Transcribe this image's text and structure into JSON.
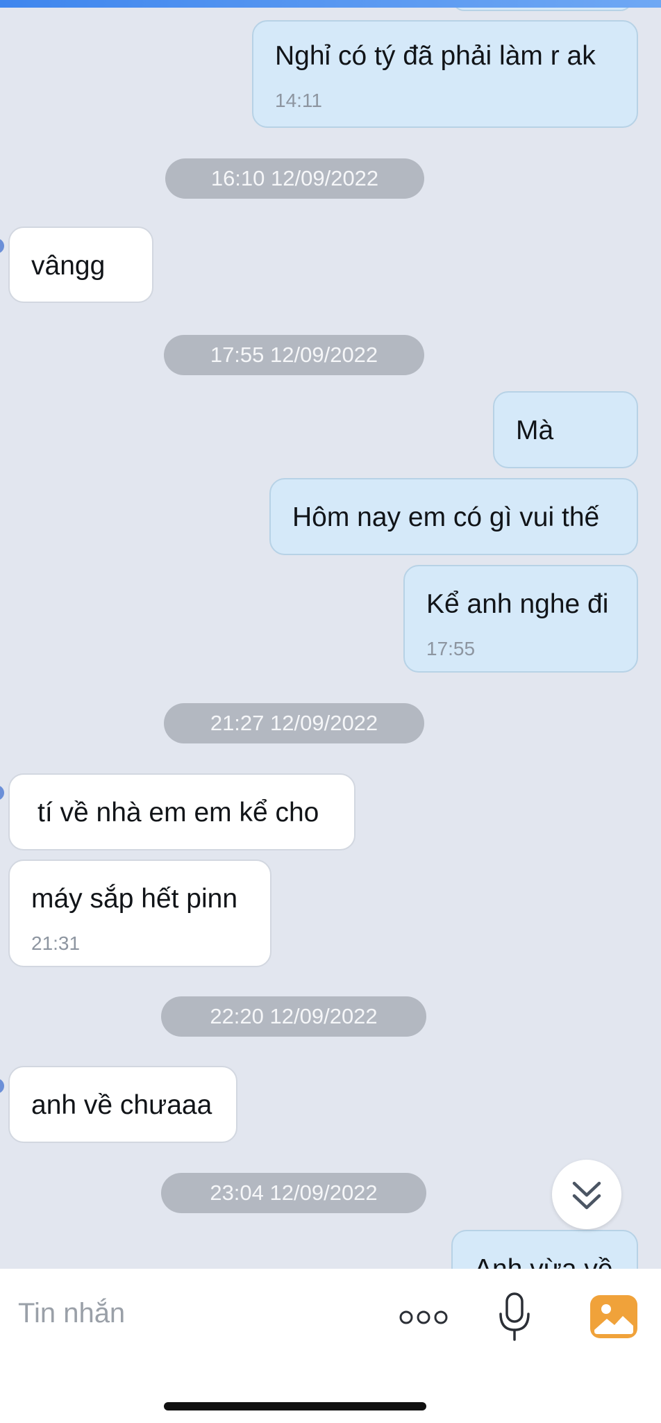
{
  "messages": [
    {
      "dir": "out",
      "text": "Nghỉ có tý đã phải làm r ak",
      "time": "14:11"
    },
    {
      "date": "16:10 12/09/2022"
    },
    {
      "dir": "in",
      "text": "vângg"
    },
    {
      "date": "17:55 12/09/2022"
    },
    {
      "dir": "out",
      "text": "Mà"
    },
    {
      "dir": "out",
      "text": "Hôm nay em có gì vui thế"
    },
    {
      "dir": "out",
      "text": "Kể anh nghe đi",
      "time": "17:55"
    },
    {
      "date": "21:27 12/09/2022"
    },
    {
      "dir": "in",
      "text": "tí về nhà em em kể cho"
    },
    {
      "dir": "in",
      "text": "máy sắp hết pinn",
      "time": "21:31"
    },
    {
      "date": "22:20 12/09/2022"
    },
    {
      "dir": "in",
      "text": "anh về chưaaa"
    },
    {
      "date": "23:04 12/09/2022"
    },
    {
      "dir": "out",
      "text": "Anh vừa về"
    }
  ],
  "input": {
    "placeholder": "Tin nhắn"
  },
  "icons": {
    "scroll_down": "double-chevron-down-icon",
    "more": "more-dots-icon",
    "mic": "microphone-icon",
    "photo": "photo-gallery-icon"
  },
  "colors": {
    "outgoing_bubble": "#d5e9f9",
    "incoming_bubble": "#ffffff",
    "chat_background": "#e2e6ef",
    "date_pill": "#b3b8c1",
    "photo_icon": "#f0a23a",
    "top_bar": "#3f86ee"
  }
}
